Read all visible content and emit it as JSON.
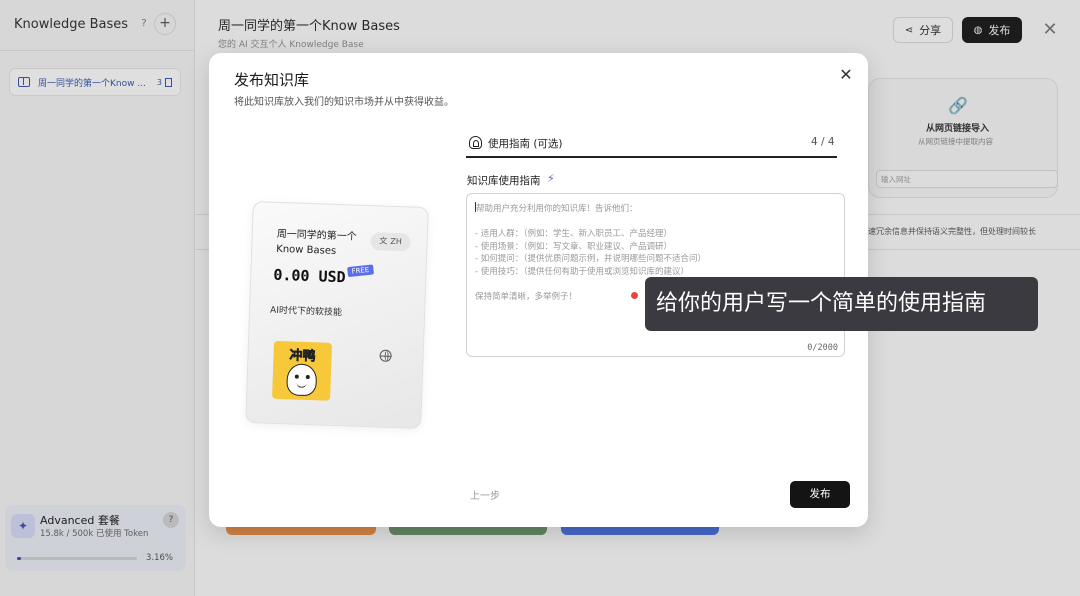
{
  "sidebar": {
    "title": "Knowledge Bases",
    "help": "?",
    "add": "+",
    "kb_item": {
      "label": "周一同学的第一个Know ...",
      "count": "3"
    },
    "plan": {
      "name": "Advanced 套餐",
      "usage": "15.8k / 500k 已使用 Token",
      "percent": "3.16%",
      "progress": 0.0316,
      "help": "?"
    }
  },
  "header": {
    "title": "周一同学的第一个Know Bases",
    "subtitle": "您的 AI 交互个人 Knowledge Base",
    "share_label": "分享",
    "publish_label": "发布",
    "close": "✕"
  },
  "background": {
    "link_title": "从网页链接导入",
    "link_sub": "从网页链接中提取内容",
    "url_placeholder": "输入网址",
    "strip_text": "速冗余信息并保持语义完整性，但处理时间较长"
  },
  "modal": {
    "title": "发布知识库",
    "subtitle": "将此知识库放入我们的知识市场并从中获得收益。",
    "close": "✕",
    "card": {
      "title": "周一同学的第一个Know Bases",
      "lang": "ZH",
      "price": "0.00 USD",
      "free_badge": "FREE",
      "desc": "AI时代下的软技能",
      "logo_text": "冲鸭"
    },
    "step": {
      "title": "使用指南 (可选)",
      "counter": "4 / 4"
    },
    "field_label": "知识库使用指南",
    "textarea": {
      "placeholder_lines": [
        "帮助用户充分利用你的知识库！告诉他们：",
        "",
        "- 适用人群：（例如：学生、新入职员工、产品经理）",
        "- 使用场景：（例如：写文章、职业建议、产品调研）",
        "- 如何提问：（提供优质问题示例，并说明哪些问题不适合问）",
        "- 使用技巧：（提供任何有助于使用或浏览知识库的建议）",
        "",
        "保持简单清晰，多举例子！"
      ],
      "char_count": "0/2000"
    },
    "prev_label": "上一步",
    "submit_label": "发布"
  },
  "tooltip": {
    "text": "给你的用户写一个简单的使用指南"
  },
  "colors": {
    "accent": "#3f49b0",
    "dark_button": "#141414",
    "free_badge": "#5b6ee8",
    "tooltip_bg": "#3a3a40",
    "dot": "#e8463c"
  }
}
